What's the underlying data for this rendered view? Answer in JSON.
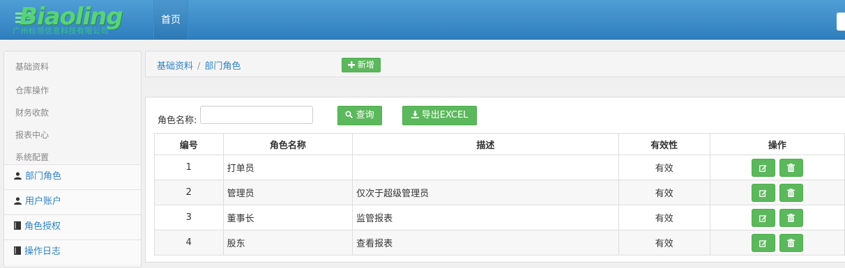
{
  "header": {
    "logo_text": "Biaoling",
    "logo_subtext": "广州标领信息科技有限公司",
    "nav_home": "首页"
  },
  "sidebar": {
    "categories": [
      "基础资料",
      "仓库操作",
      "财务收款",
      "报表中心",
      "系统配置"
    ],
    "items": [
      {
        "label": "部门角色",
        "icon": "user-icon"
      },
      {
        "label": "用户账户",
        "icon": "user-icon"
      },
      {
        "label": "角色授权",
        "icon": "book-icon"
      },
      {
        "label": "操作日志",
        "icon": "book-icon"
      }
    ]
  },
  "breadcrumb": {
    "root": "基础资料",
    "separator": "/",
    "current": "部门角色"
  },
  "toolbar": {
    "add_label": "新增",
    "filter_label": "角色名称:",
    "filter_value": "",
    "query_label": "查询",
    "export_label": "导出EXCEL"
  },
  "table": {
    "columns": [
      "编号",
      "角色名称",
      "描述",
      "有效性",
      "操作"
    ],
    "rows": [
      {
        "id": "1",
        "name": "打单员",
        "desc": "",
        "valid": "有效"
      },
      {
        "id": "2",
        "name": "管理员",
        "desc": "仅次于超级管理员",
        "valid": "有效"
      },
      {
        "id": "3",
        "name": "董事长",
        "desc": "监管报表",
        "valid": "有效"
      },
      {
        "id": "4",
        "name": "股东",
        "desc": "查看报表",
        "valid": "有效"
      }
    ]
  },
  "colors": {
    "header_blue": "#3a8bcb",
    "accent_green": "#5cb85c",
    "link_blue": "#2f83c5",
    "logo_green": "#57d47a"
  }
}
